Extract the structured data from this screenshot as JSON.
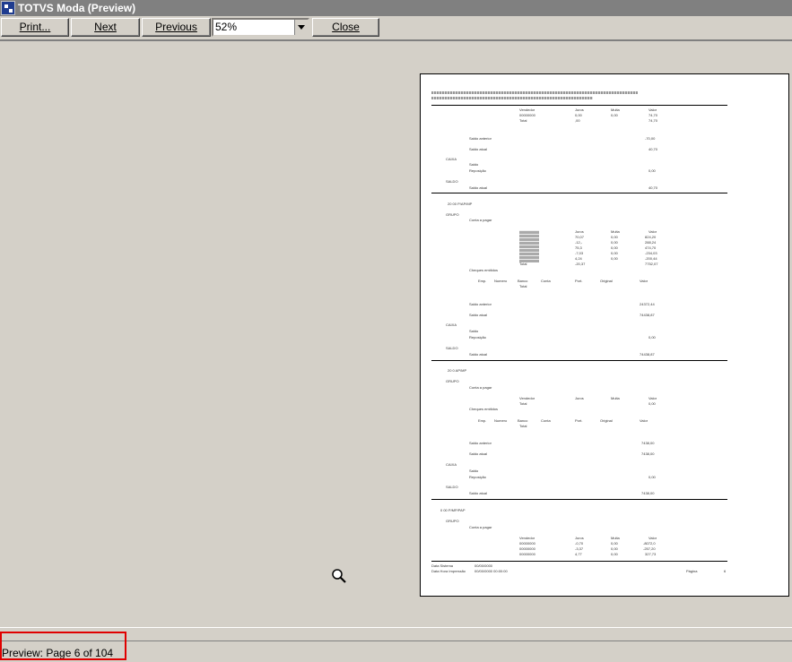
{
  "window": {
    "title": "TOTVS Moda (Preview)"
  },
  "toolbar": {
    "print_label": "Print...",
    "next_label": "Next",
    "previous_label": "Previous",
    "zoom_value": "52%",
    "close_label": "Close"
  },
  "status": {
    "text": "Preview: Page 6 of 104"
  },
  "preview": {
    "section2_title": "20 00 P/AP/MP",
    "section3_title": "20 0 AP/MP",
    "section4_title": "0 00 P/MP/PAP",
    "footer_page_label": "Página",
    "footer_page_num": "6"
  }
}
